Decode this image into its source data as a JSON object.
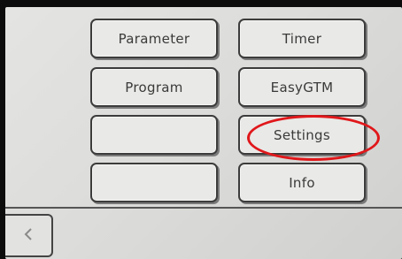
{
  "menu": {
    "parameter_label": "Parameter",
    "timer_label": "Timer",
    "program_label": "Program",
    "easygtm_label": "EasyGTM",
    "blank_left_3_label": "",
    "settings_label": "Settings",
    "blank_left_4_label": "",
    "info_label": "Info"
  },
  "nav": {
    "back_icon": "chevron-left-icon"
  },
  "colors": {
    "screen_bg": "#e0e0de",
    "button_border": "#3c3c3c",
    "button_text": "#3a3a3a",
    "highlight": "#e0171a"
  }
}
